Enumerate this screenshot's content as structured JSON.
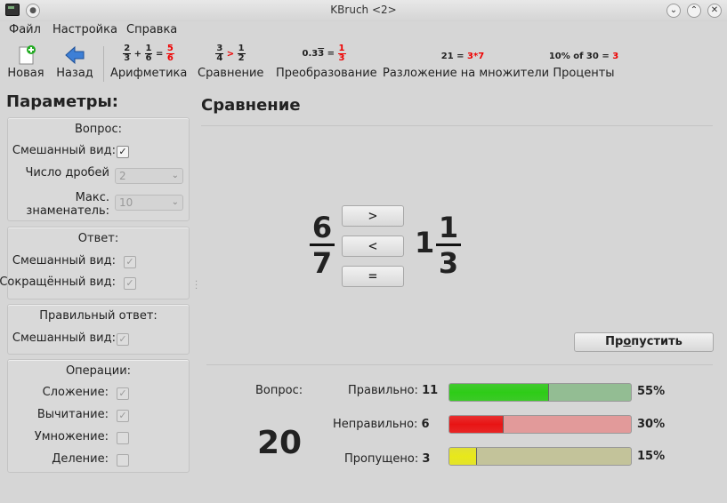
{
  "window": {
    "title": "KBruch <2>",
    "colors": {
      "correct": "#2ecc17",
      "incorrect": "#e81414",
      "skipped": "#e8e81a"
    }
  },
  "menu": {
    "file": "Файл",
    "settings": "Настройка",
    "help": "Справка"
  },
  "toolbar": {
    "new_label": "Новая",
    "back_label": "Назад",
    "arith": {
      "label": "Арифметика",
      "a_n": "2",
      "a_d": "3",
      "op": "+",
      "b_n": "1",
      "b_d": "6",
      "eq": "=",
      "r_n": "5",
      "r_d": "6"
    },
    "compare": {
      "label": "Сравнение",
      "a_n": "3",
      "a_d": "4",
      "op": ">",
      "b_n": "1",
      "b_d": "2"
    },
    "convert": {
      "label": "Преобразование",
      "left": "0.3",
      "bar": "3",
      "eq": "=",
      "r_n": "1",
      "r_d": "3"
    },
    "factorize": {
      "label": "Разложение на множители",
      "left": "21 =",
      "right": "3*7"
    },
    "percent": {
      "label": "Проценты",
      "left": "10% of 30 =",
      "right": "3"
    }
  },
  "params": {
    "title": "Параметры:",
    "question": {
      "title": "Вопрос:",
      "mixed_label": "Смешанный вид:",
      "mixed_checked": true,
      "fraction_count_label": "Число дробей",
      "fraction_count_value": "2",
      "max_denom_label_1": "Макс.",
      "max_denom_label_2": "знаменатель:",
      "max_denom_value": "10"
    },
    "answer": {
      "title": "Ответ:",
      "mixed_label": "Смешанный вид:",
      "reduced_label": "Сокращённый вид:"
    },
    "correct_answer": {
      "title": "Правильный ответ:",
      "mixed_label": "Смешанный вид:"
    },
    "operations": {
      "title": "Операции:",
      "add_label": "Сложение:",
      "sub_label": "Вычитание:",
      "mul_label": "Умножение:",
      "div_label": "Деление:"
    }
  },
  "exercise": {
    "title": "Сравнение",
    "left_num": "6",
    "left_den": "7",
    "right_whole": "1",
    "right_num": "1",
    "right_den": "3",
    "btn_greater": ">",
    "btn_less": "<",
    "btn_equal": "=",
    "skip_prefix": "Пр",
    "skip_accel": "о",
    "skip_suffix": "пустить"
  },
  "stats": {
    "question_label": "Вопрос:",
    "question_count": "20",
    "correct_label": "Правильно:",
    "correct_count": "11",
    "correct_pct": "55%",
    "correct_fraction": 0.55,
    "incorrect_label": "Неправильно:",
    "incorrect_count": "6",
    "incorrect_pct": "30%",
    "incorrect_fraction": 0.3,
    "skipped_label": "Пропущено:",
    "skipped_count": "3",
    "skipped_pct": "15%",
    "skipped_fraction": 0.15
  }
}
